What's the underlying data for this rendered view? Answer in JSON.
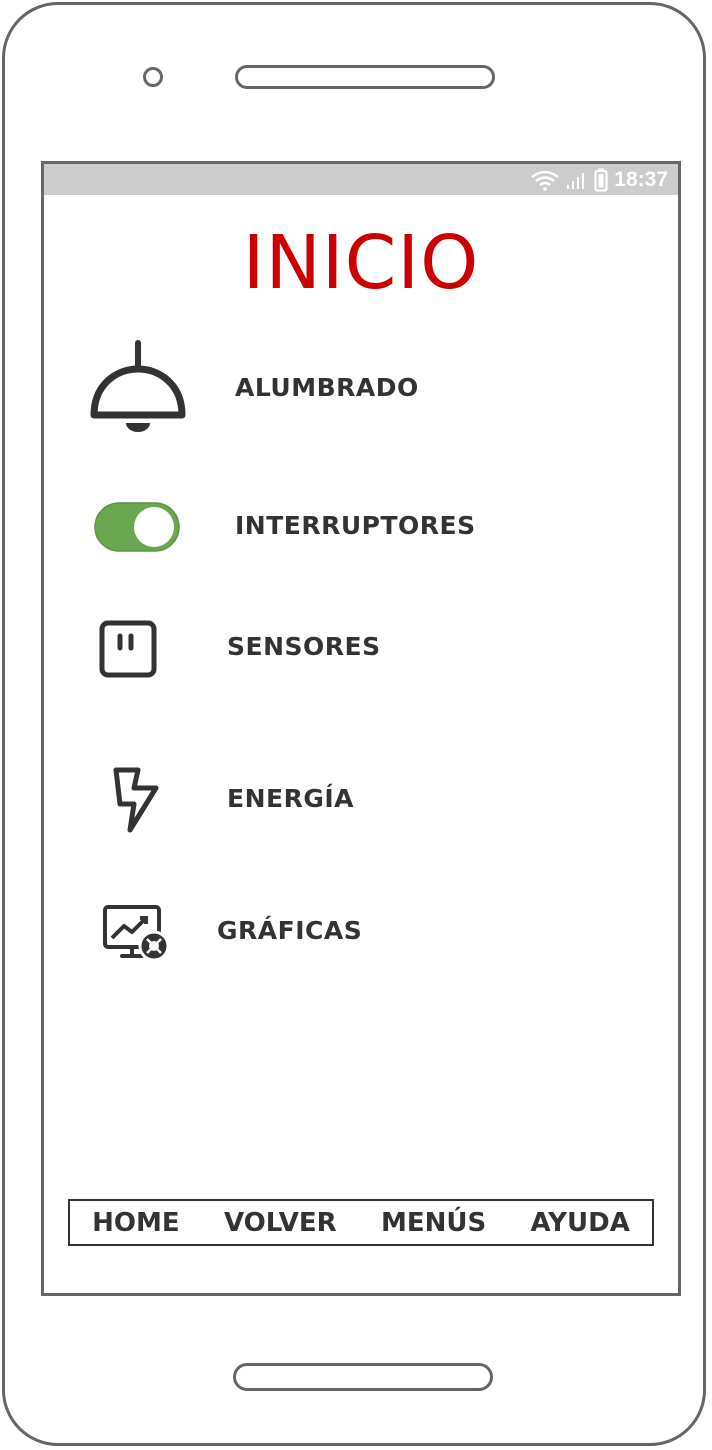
{
  "status_bar": {
    "time": "18:37",
    "icons": [
      "wifi-icon",
      "signal-icon",
      "battery-icon"
    ]
  },
  "page": {
    "title": "INICIO"
  },
  "menu": {
    "items": [
      {
        "label": "ALUMBRADO",
        "icon": "lamp-icon"
      },
      {
        "label": "INTERRUPTORES",
        "icon": "toggle-switch-icon",
        "toggle_on": true
      },
      {
        "label": "SENSORES",
        "icon": "power-outlet-icon"
      },
      {
        "label": "ENERGÍA",
        "icon": "lightning-icon"
      },
      {
        "label": "GRÁFICAS",
        "icon": "monitor-chart-icon"
      }
    ]
  },
  "bottom_nav": {
    "home": "HOME",
    "back": "VOLVER",
    "menus": "MENÚS",
    "help": "AYUDA"
  },
  "colors": {
    "title": "#cc0000",
    "toggle_on": "#6aa84f",
    "text": "#333333",
    "status_bar": "#cccccc"
  }
}
